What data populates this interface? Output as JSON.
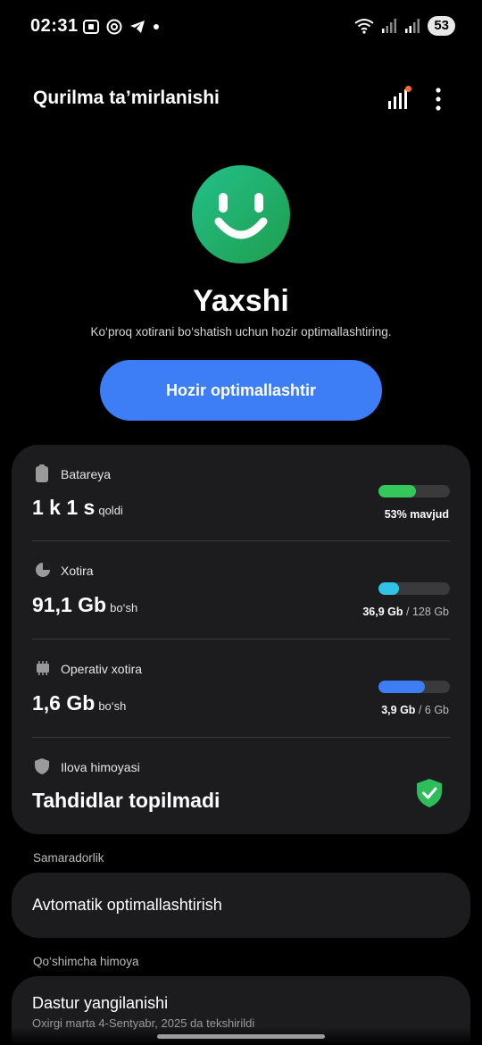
{
  "status_bar": {
    "time": "02:31",
    "battery_level": "53",
    "icons_left": [
      "screenshot-icon",
      "chatgpt-icon",
      "telegram-icon",
      "dot-icon"
    ],
    "icons_right": [
      "wifi-icon",
      "signal-icon",
      "signal-icon-2"
    ]
  },
  "header": {
    "title": "Qurilma ta’mirlanishi",
    "icons": [
      "diagnostics-icon",
      "more-options-icon"
    ],
    "notification_color": "#ff6a3d"
  },
  "hero": {
    "status_word": "Yaxshi",
    "hint": "Ko‘proq xotirani bo‘shatish uchun hozir optimallashtiring.",
    "button_label": "Hozir optimallashtir"
  },
  "battery": {
    "label": "Batareya",
    "value": "1 k 1 s",
    "unit": "qoldi",
    "caption": "53% mavjud",
    "level": 0.53,
    "color": "#34c759"
  },
  "storage": {
    "label": "Xotira",
    "value": "91,1 Gb",
    "unit": "bo‘sh",
    "used": "36,9 Gb",
    "separator": "/",
    "total": "128 Gb",
    "level": 0.29,
    "color": "#2ec4e6"
  },
  "ram": {
    "label": "Operativ xotira",
    "value": "1,6 Gb",
    "unit": "bo‘sh",
    "used": "3,9 Gb",
    "separator": "/",
    "total": "6 Gb",
    "level": 0.65,
    "color": "#3d7ef7"
  },
  "app_protection": {
    "label": "Ilova himoyasi",
    "value": "Tahdidlar topilmadi",
    "color": "#2dbd5a"
  },
  "performance": {
    "section_label": "Samaradorlik",
    "item_label": "Avtomatik optimallashtirish"
  },
  "extra_protection": {
    "section_label": "Qo‘shimcha himoya",
    "item_label": "Dastur yangilanishi",
    "item_sub": "Oxirgi marta 4-Sentyabr, 2025 da tekshirildi"
  }
}
